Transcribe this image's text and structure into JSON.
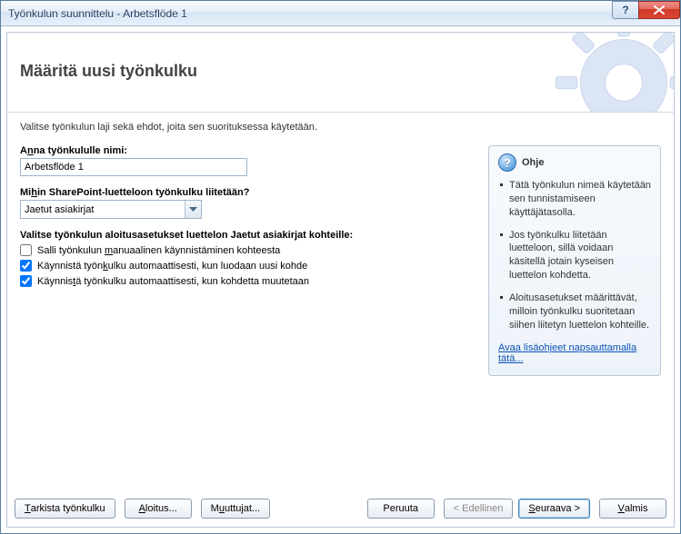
{
  "window": {
    "title": "Työnkulun suunnittelu - Arbetsflöde 1"
  },
  "banner": {
    "title": "Määritä uusi työnkulku"
  },
  "intro": "Valitse työnkulun laji sekä ehdot, joita sen suorituksessa käytetään.",
  "name_field": {
    "label_pre": "A",
    "label_u": "n",
    "label_post": "na työnkululle nimi:",
    "value": "Arbetsflöde 1"
  },
  "list_field": {
    "label_pre": "Mi",
    "label_u": "h",
    "label_post": "in SharePoint-luetteloon työnkulku liitetään?",
    "value": "Jaetut asiakirjat"
  },
  "start_settings": {
    "heading": "Valitse työnkulun aloitusasetukset luettelon Jaetut asiakirjat kohteille:",
    "opt1": {
      "pre": "Salli työnkulun ",
      "u": "m",
      "post": "anuaalinen käynnistäminen kohteesta",
      "checked": false
    },
    "opt2": {
      "pre": "Käynnistä työn",
      "u": "k",
      "post": "ulku automaattisesti, kun luodaan uusi kohde",
      "checked": true
    },
    "opt3": {
      "pre": "Käynnis",
      "u": "t",
      "post": "ä työnkulku automaattisesti, kun kohdetta muutetaan",
      "checked": true
    }
  },
  "help": {
    "title": "Ohje",
    "items": [
      "Tätä työnkulun nimeä käytetään sen tunnistamiseen käyttäjätasolla.",
      "Jos työnkulku liitetään luetteloon, sillä voidaan käsitellä jotain kyseisen luettelon kohdetta.",
      "Aloitusasetukset määrittävät, milloin työnkulku suoritetaan siihen liitetyn luettelon kohteille."
    ],
    "link": "Avaa lisäohjeet napsauttamalla tätä..."
  },
  "buttons": {
    "check": {
      "pre": "",
      "u": "T",
      "post": "arkista työnkulku"
    },
    "init": {
      "pre": "",
      "u": "A",
      "post": "loitus..."
    },
    "vars": {
      "pre": "M",
      "u": "u",
      "post": "uttujat..."
    },
    "cancel": "Peruuta",
    "back": "< Edellinen",
    "next": {
      "pre": "",
      "u": "S",
      "post": "euraava >"
    },
    "finish": {
      "pre": "",
      "u": "V",
      "post": "almis"
    }
  }
}
